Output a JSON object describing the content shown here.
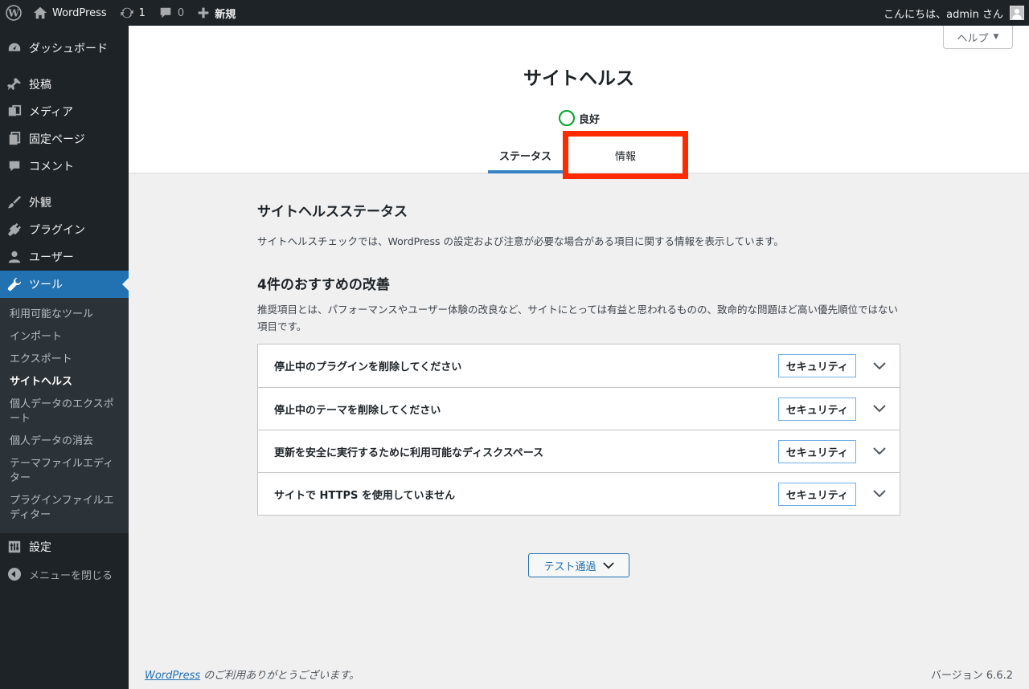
{
  "adminbar": {
    "site_name": "WordPress",
    "updates_count": "1",
    "comments_count": "0",
    "new_label": "新規",
    "greeting": "こんにちは、admin さん"
  },
  "sidebar": {
    "dashboard": "ダッシュボード",
    "posts": "投稿",
    "media": "メディア",
    "pages": "固定ページ",
    "comments": "コメント",
    "appearance": "外観",
    "plugins": "プラグイン",
    "users": "ユーザー",
    "tools": "ツール",
    "tools_submenu": [
      "利用可能なツール",
      "インポート",
      "エクスポート",
      "サイトヘルス",
      "個人データのエクスポート",
      "個人データの消去",
      "テーマファイルエディター",
      "プラグインファイルエディター"
    ],
    "settings": "設定",
    "collapse": "メニューを閉じる"
  },
  "header": {
    "help": "ヘルプ",
    "title": "サイトヘルス",
    "health_status": "良好",
    "tabs": [
      "ステータス",
      "情報"
    ]
  },
  "main": {
    "status_heading": "サイトヘルスステータス",
    "status_desc": "サイトヘルスチェックでは、WordPress の設定および注意が必要な場合がある項目に関する情報を表示しています。",
    "issues_heading": "4件のおすすめの改善",
    "issues_desc": "推奨項目とは、パフォーマンスやユーザー体験の改良など、サイトにとっては有益と思われるものの、致命的な問題ほど高い優先順位ではない項目です。",
    "issues": [
      {
        "title": "停止中のプラグインを削除してください",
        "badge": "セキュリティ"
      },
      {
        "title": "停止中のテーマを削除してください",
        "badge": "セキュリティ"
      },
      {
        "title": "更新を安全に実行するために利用可能なディスクスペース",
        "badge": "セキュリティ"
      },
      {
        "title": "サイトで HTTPS を使用していません",
        "badge": "セキュリティ"
      }
    ],
    "passed_button": "テスト通過"
  },
  "footer": {
    "wp_link": "WordPress",
    "thanks": " のご利用ありがとうございます。",
    "version": "バージョン 6.6.2"
  },
  "colors": {
    "accent": "#2271b1",
    "highlight_box": "#ff2a00",
    "health_good": "#00a32a",
    "sidebar_bg": "#1d2327"
  }
}
